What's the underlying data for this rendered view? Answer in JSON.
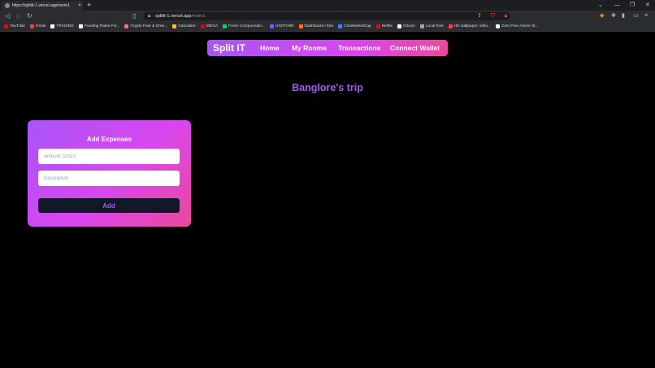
{
  "browser": {
    "tab_title": "https://splitit-1.vercel.app/room1",
    "tab_close": "×",
    "new_tab": "+",
    "url_host": "splitit-1.vercel.app",
    "url_path": "/room1",
    "bookmarks": [
      {
        "label": "YouTube",
        "color": "#ff0000"
      },
      {
        "label": "Gmail",
        "color": "#ea4335"
      },
      {
        "label": "TRADING",
        "color": "#ffffff"
      },
      {
        "label": "Funding Rates For...",
        "color": "#ffffff"
      },
      {
        "label": "Crypto Fear & Gree...",
        "color": "#f87171"
      },
      {
        "label": "Calculator",
        "color": "#fbbf24"
      },
      {
        "label": "MEGA",
        "color": "#d90007"
      },
      {
        "label": "Forex Compoundin...",
        "color": "#22c55e"
      },
      {
        "label": "USDT/INR",
        "color": "#6366f1"
      },
      {
        "label": "Dashboard / Kite",
        "color": "#f97316"
      },
      {
        "label": "CoinMarketCap",
        "color": "#3b82f6"
      },
      {
        "label": "Netflix",
        "color": "#e50914"
      },
      {
        "label": "Gitcoin",
        "color": "#ffffff"
      },
      {
        "label": "Local host",
        "color": "#9ca3af"
      },
      {
        "label": "HD wallpaper: silho...",
        "color": "#ef4444"
      },
      {
        "label": "Zoro Free Anime St...",
        "color": "#ffffff"
      }
    ]
  },
  "nav": {
    "brand": "Split IT",
    "links": [
      "Home",
      "My Rooms",
      "Transactions",
      "Connect Wallet"
    ]
  },
  "room": {
    "title": "Banglore's trip"
  },
  "expense_form": {
    "title": "Add Expenses",
    "amount_placeholder": "Amount (USD)",
    "description_placeholder": "Description",
    "amount_value": "",
    "description_value": "",
    "submit_label": "Add"
  },
  "colors": {
    "accent": "#a855f7",
    "gradient_end": "#ec4899",
    "button_bg": "#111827"
  }
}
